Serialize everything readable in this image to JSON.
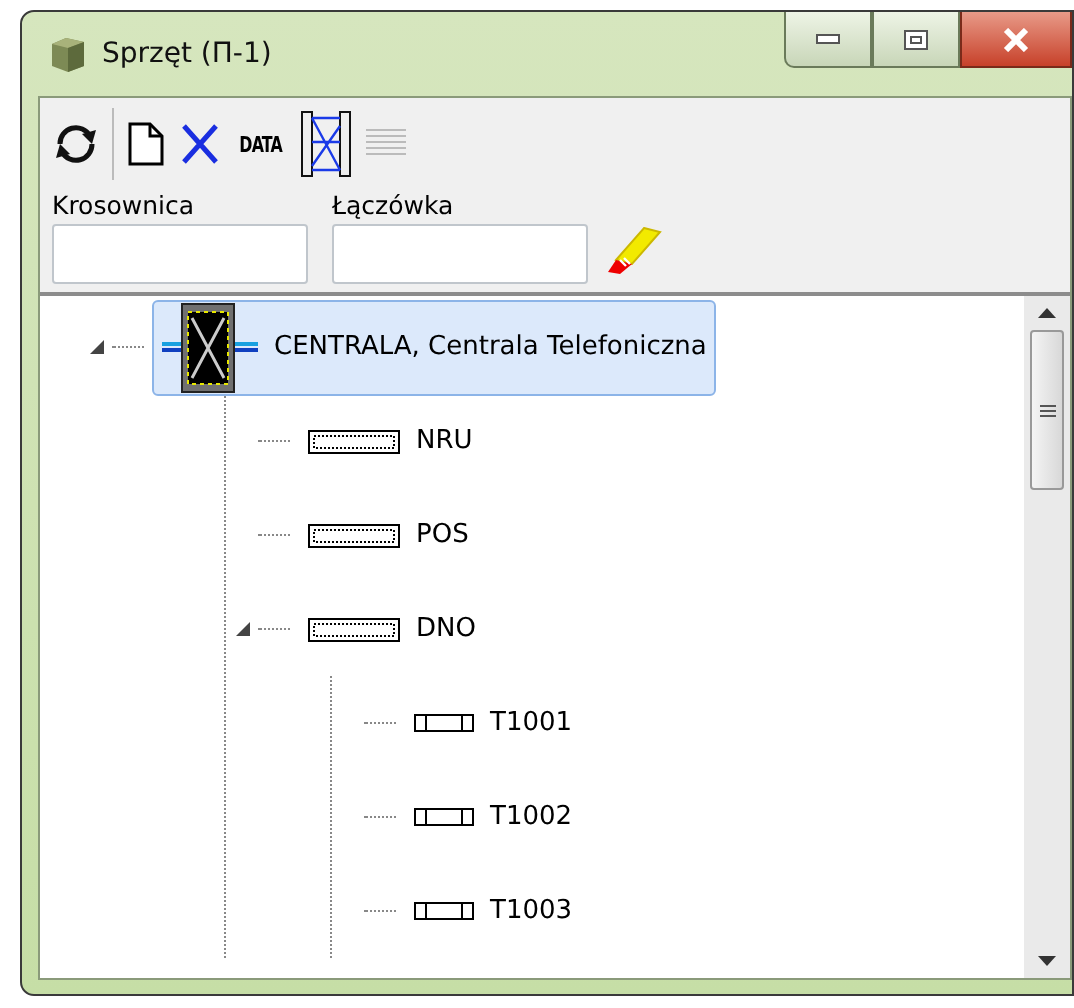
{
  "window": {
    "title": "Sprzęt (П-1)"
  },
  "toolbar": [
    {
      "kind": "refresh"
    },
    {
      "kind": "new"
    },
    {
      "kind": "delete"
    },
    {
      "kind": "data",
      "text": "DATA"
    },
    {
      "kind": "crossconnect"
    },
    {
      "kind": "list",
      "disabled": true
    }
  ],
  "fields": [
    {
      "label": "Krosownica"
    },
    {
      "label": "Łączówka"
    }
  ],
  "tree": [
    {
      "label": "CENTRALA, Centrala Telefoniczna",
      "kind": "exchange",
      "selected": true,
      "expanded": true,
      "children": [
        {
          "label": "NRU",
          "kind": "panel",
          "selected": false
        },
        {
          "label": "POS",
          "kind": "panel",
          "selected": false
        },
        {
          "label": "DNO",
          "kind": "panel",
          "selected": false,
          "expanded": true,
          "children": [
            {
              "label": "T1001",
              "kind": "terminal",
              "selected": false
            },
            {
              "label": "T1002",
              "kind": "terminal",
              "selected": false
            },
            {
              "label": "T1003",
              "kind": "terminal",
              "selected": false
            }
          ]
        }
      ]
    }
  ]
}
